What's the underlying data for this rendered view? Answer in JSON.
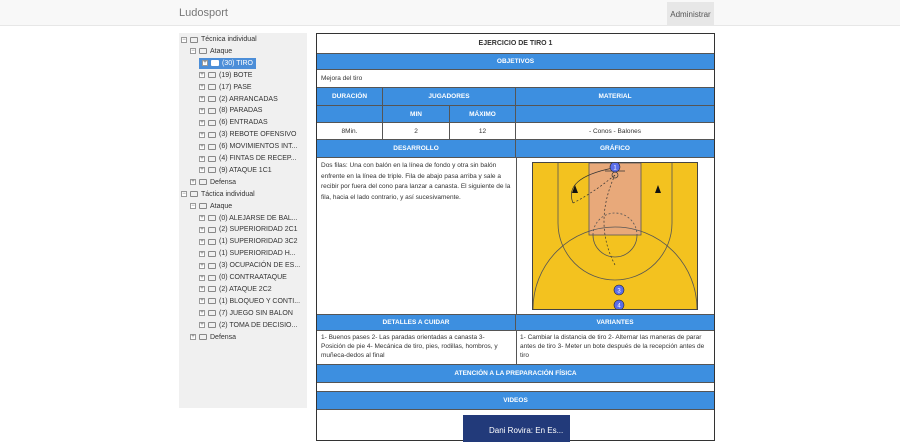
{
  "navbar": {
    "brand": "Ludosport",
    "admin": "Administrar"
  },
  "tree": [
    {
      "label": "Técnica individual",
      "level": 0,
      "sign": "−"
    },
    {
      "label": "Ataque",
      "level": 1,
      "sign": "−"
    },
    {
      "label": "(30) TIRO",
      "level": 2,
      "sign": "+",
      "selected": true
    },
    {
      "label": "(19) BOTE",
      "level": 2,
      "sign": "+"
    },
    {
      "label": "(17) PASE",
      "level": 2,
      "sign": "+"
    },
    {
      "label": "(2) ARRANCADAS",
      "level": 2,
      "sign": "+"
    },
    {
      "label": "(8) PARADAS",
      "level": 2,
      "sign": "+"
    },
    {
      "label": "(6) ENTRADAS",
      "level": 2,
      "sign": "+"
    },
    {
      "label": "(3) REBOTE OFENSIVO",
      "level": 2,
      "sign": "+"
    },
    {
      "label": "(6) MOVIMIENTOS INT...",
      "level": 2,
      "sign": "+"
    },
    {
      "label": "(4) FINTAS DE RECEP...",
      "level": 2,
      "sign": "+"
    },
    {
      "label": "(9) ATAQUE 1C1",
      "level": 2,
      "sign": "+"
    },
    {
      "label": "Defensa",
      "level": 1,
      "sign": "+"
    },
    {
      "label": "Táctica individual",
      "level": 0,
      "sign": "−"
    },
    {
      "label": "Ataque",
      "level": 1,
      "sign": "−"
    },
    {
      "label": "(0) ALEJARSE DE BAL...",
      "level": 2,
      "sign": "+"
    },
    {
      "label": "(2) SUPERIORIDAD 2C1",
      "level": 2,
      "sign": "+"
    },
    {
      "label": "(1) SUPERIORIDAD 3C2",
      "level": 2,
      "sign": "+"
    },
    {
      "label": "(1) SUPERIORIDAD H...",
      "level": 2,
      "sign": "+"
    },
    {
      "label": "(3) OCUPACIÓN DE ES...",
      "level": 2,
      "sign": "+"
    },
    {
      "label": "(0) CONTRAATAQUE",
      "level": 2,
      "sign": "+"
    },
    {
      "label": "(2) ATAQUE 2C2",
      "level": 2,
      "sign": "+"
    },
    {
      "label": "(1) BLOQUEO Y CONTI...",
      "level": 2,
      "sign": "+"
    },
    {
      "label": "(7) JUEGO SIN BALON",
      "level": 2,
      "sign": "+"
    },
    {
      "label": "(2) TOMA DE DECISIO...",
      "level": 2,
      "sign": "+"
    },
    {
      "label": "Defensa",
      "level": 1,
      "sign": "+"
    }
  ],
  "exercise": {
    "title": "EJERCICIO DE TIRO 1",
    "objetivos_header": "OBJETIVOS",
    "objetivos_text": "Mejora del tiro",
    "duracion_header": "DURACIÓN",
    "jugadores_header": "JUGADORES",
    "material_header": "MATERIAL",
    "min_header": "MIN",
    "max_header": "MÁXIMO",
    "duracion": "8Min.",
    "min": "2",
    "max": "12",
    "material": "- Conos - Balones",
    "desarrollo_header": "DESARROLLO",
    "grafico_header": "GRÁFICO",
    "desarrollo_text": "Dos filas: Una con balón en la línea de fondo y otra sin balón enfrente en la línea de triple. Fila de abajo pasa arriba y sale a recibir por fuera del cono para lanzar a canasta. El siguiente de la fila, hacia el lado contrario, y así sucesivamente.",
    "detalles_header": "DETALLES A CUIDAR",
    "variantes_header": "VARIANTES",
    "detalles_text": "1- Buenos pases 2- Las paradas orientadas a canasta 3- Posición de pie 4- Mecánica de tiro, pies, rodillas, hombros, y muñeca-dedos al final",
    "variantes_text": "1- Cambiar la distancia de tiro 2- Alternar las maneras de parar antes de tiro 3- Meter un bote después de la recepción antes de tiro",
    "atencion_header": "ATENCIÓN A LA PREPARACIÓN FÍSICA",
    "videos_header": "VIDEOS",
    "video_title": "Dani Rovira: En Es...",
    "players": [
      "1",
      "3",
      "4"
    ]
  },
  "colors": {
    "header_blue": "#3d8fe0",
    "selected_blue": "#4c8ed8",
    "court_yellow": "#f3c21f"
  }
}
